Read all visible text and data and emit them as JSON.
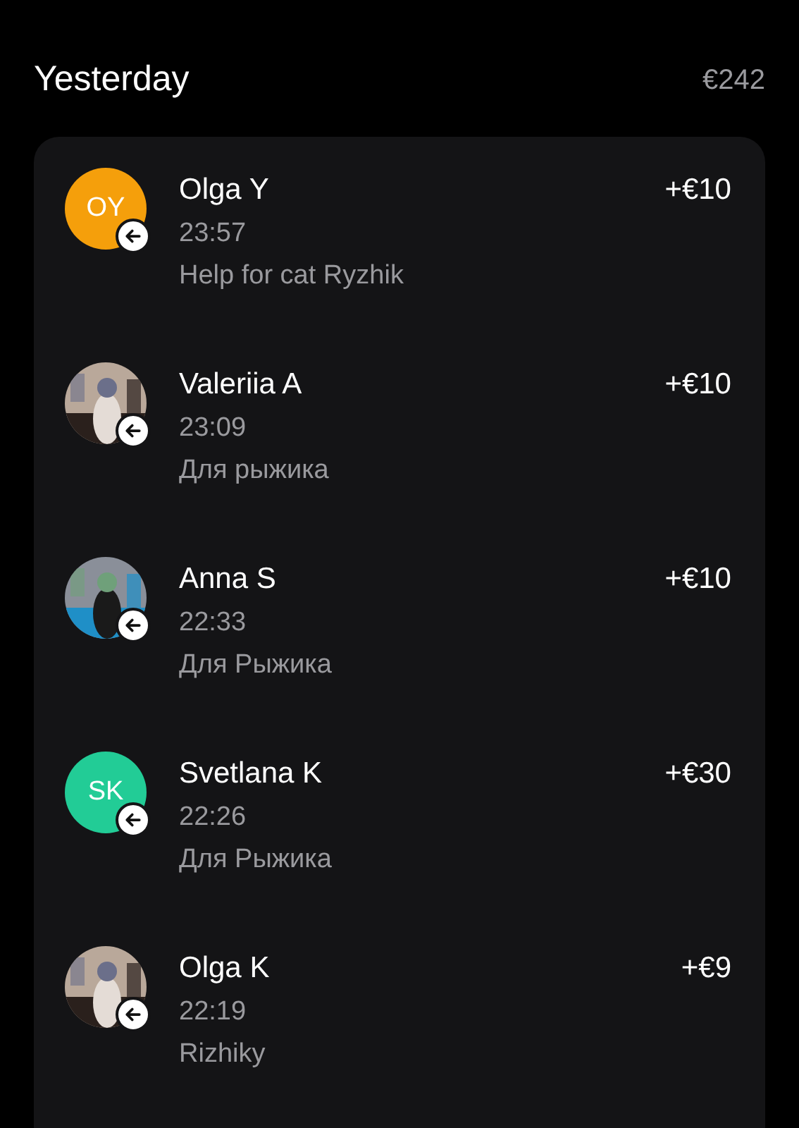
{
  "header": {
    "title": "Yesterday",
    "total": "€242"
  },
  "transactions": [
    {
      "avatar": {
        "kind": "initials",
        "initials": "OY",
        "color": "#f59f0b"
      },
      "name": "Olga Y",
      "time": "23:57",
      "note": "Help for cat Ryzhik",
      "amount": "+€10"
    },
    {
      "name": "Valeriia A",
      "time": "23:09",
      "note": "Для рыжика",
      "amount": "+€10"
    },
    {
      "name": "Anna S",
      "time": "22:33",
      "note": "Для Рыжика",
      "amount": "+€10"
    },
    {
      "avatar": {
        "kind": "initials",
        "initials": "SK",
        "color": "#22cc96"
      },
      "name": "Svetlana K",
      "time": "22:26",
      "note": "Для Рыжика",
      "amount": "+€30"
    },
    {
      "name": "Olga K",
      "time": "22:19",
      "note": "Rizhiky",
      "amount": "+€9"
    }
  ]
}
